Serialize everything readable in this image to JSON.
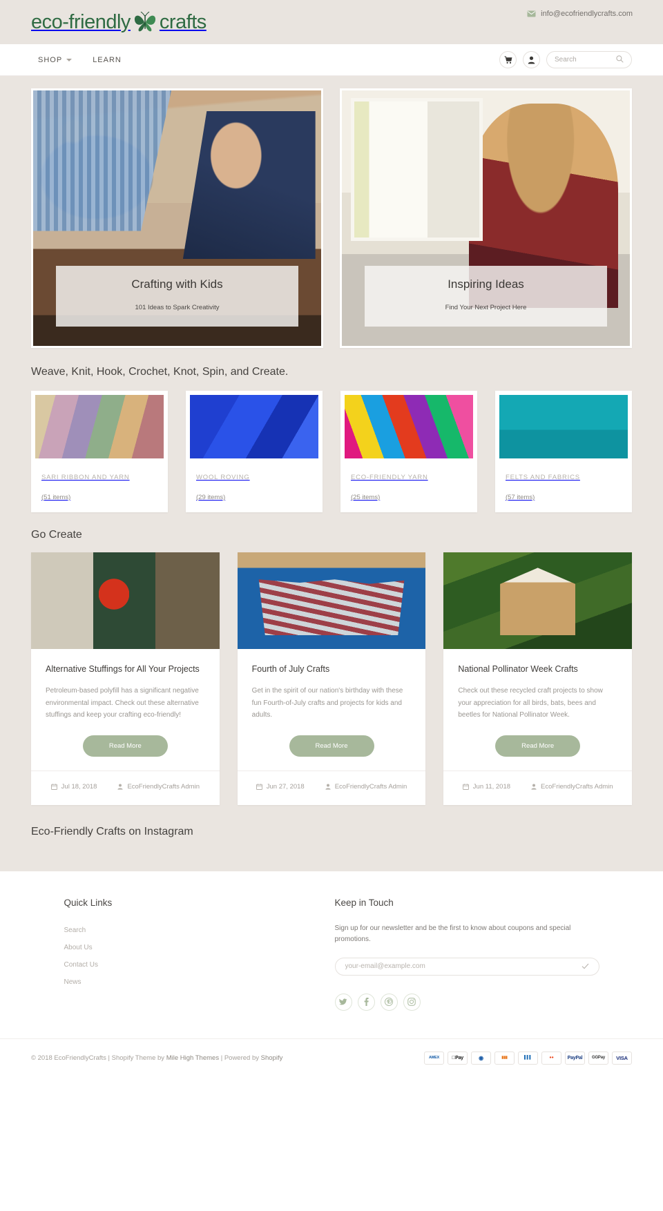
{
  "topbar": {
    "logo_text_left": "eco-friendly",
    "logo_text_right": "crafts",
    "logo_icon": "butterfly-icon",
    "email": "info@ecofriendlycrafts.com",
    "email_icon": "envelope-icon",
    "brand_color": "#2f6b43"
  },
  "nav": {
    "items": [
      {
        "label": "SHOP",
        "has_dropdown": true
      },
      {
        "label": "LEARN",
        "has_dropdown": false
      }
    ],
    "cart_icon": "shopping-cart-icon",
    "account_icon": "user-icon",
    "search": {
      "placeholder": "Search",
      "value": "",
      "icon": "search-icon"
    }
  },
  "hero": {
    "banners": [
      {
        "title": "Crafting with Kids",
        "subtitle": "101 Ideas to Spark Creativity",
        "image": "dad-and-child-crafting-photo"
      },
      {
        "title": "Inspiring Ideas",
        "subtitle": "Find Your Next Project Here",
        "image": "woman-painting-photo"
      }
    ]
  },
  "tagline": "Weave, Knit, Hook, Crochet, Knot, Spin, and Create.",
  "categories": [
    {
      "name": "SARI RIBBON AND YARN",
      "count": "(51 items)",
      "swatch": "sw-sari"
    },
    {
      "name": "WOOL ROVING",
      "count": "(29 items)",
      "swatch": "sw-wool"
    },
    {
      "name": "ECO-FRIENDLY YARN",
      "count": "(25 items)",
      "swatch": "sw-eco"
    },
    {
      "name": "FELTS AND FABRICS",
      "count": "(57 items)",
      "swatch": "sw-felt"
    }
  ],
  "blog": {
    "heading": "Go Create",
    "read_more_label": "Read More",
    "posts": [
      {
        "title": "Alternative Stuffings for All Your Projects",
        "excerpt": "Petroleum-based polyfill has a significant negative environmental impact. Check out these alternative stuffings and keep your crafting eco-friendly!",
        "date": "Jul 18, 2018",
        "author": "EcoFriendlyCrafts Admin",
        "image": "cotton-flowers-and-tree-collage-photo"
      },
      {
        "title": "Fourth of July Crafts",
        "excerpt": "Get in the spirit of our nation's birthday with these fun Fourth-of-July crafts and projects for kids and adults.",
        "date": "Jun 27, 2018",
        "author": "EcoFriendlyCrafts Admin",
        "image": "american-flag-bunting-photo"
      },
      {
        "title": "National Pollinator Week Crafts",
        "excerpt": "Check out these recycled craft projects to show your appreciation for all birds, bats, bees and beetles for National Pollinator Week.",
        "date": "Jun 11, 2018",
        "author": "EcoFriendlyCrafts Admin",
        "image": "bug-hotel-in-greenery-photo"
      }
    ]
  },
  "instagram": {
    "heading": "Eco-Friendly Crafts on Instagram"
  },
  "footer": {
    "quick_links": {
      "heading": "Quick Links",
      "items": [
        "Search",
        "About Us",
        "Contact Us",
        "News"
      ]
    },
    "keep_in_touch": {
      "heading": "Keep in Touch",
      "description": "Sign up for our newsletter and be the first to know about coupons and special promotions.",
      "email_placeholder": "your-email@example.com",
      "email_value": "",
      "submit_icon": "check-icon"
    },
    "social": [
      {
        "name": "twitter-icon",
        "label": "Twitter"
      },
      {
        "name": "facebook-icon",
        "label": "Facebook"
      },
      {
        "name": "pinterest-icon",
        "label": "Pinterest"
      },
      {
        "name": "instagram-icon",
        "label": "Instagram"
      }
    ],
    "bottom": {
      "copyright_prefix": "© 2018 EcoFriendlyCrafts | Shopify Theme by ",
      "theme_link": "Mile High Themes",
      "copyright_middle": " | Powered by ",
      "platform_link": "Shopify",
      "payments": [
        {
          "id": "amex",
          "label": "AMEX"
        },
        {
          "id": "apple-pay",
          "label": "Pay"
        },
        {
          "id": "diners",
          "label": "DC"
        },
        {
          "id": "discover",
          "label": "DISC"
        },
        {
          "id": "jcb",
          "label": "JCB"
        },
        {
          "id": "mastercard",
          "label": "MC"
        },
        {
          "id": "paypal",
          "label": "PayPal"
        },
        {
          "id": "google-pay",
          "label": "GPay"
        },
        {
          "id": "visa",
          "label": "VISA"
        }
      ]
    }
  },
  "accent_green": "#a7b89b"
}
